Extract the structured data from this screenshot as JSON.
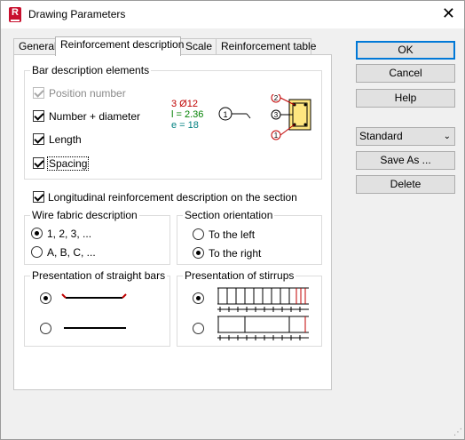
{
  "window": {
    "title": "Drawing Parameters",
    "app_icon_letter": "R"
  },
  "tabs": [
    "General",
    "Reinforcement description",
    "Scale",
    "Reinforcement table"
  ],
  "buttons": {
    "ok": "OK",
    "cancel": "Cancel",
    "help": "Help",
    "save_as": "Save As ...",
    "delete": "Delete"
  },
  "style_combo": {
    "value": "Standard"
  },
  "bar_description": {
    "title": "Bar description elements",
    "items": [
      {
        "label": "Position number",
        "checked": true,
        "disabled": true
      },
      {
        "label": "Number + diameter",
        "checked": true,
        "disabled": false
      },
      {
        "label": "Length",
        "checked": true,
        "disabled": false
      },
      {
        "label": "Spacing",
        "checked": true,
        "disabled": false
      }
    ],
    "preview": {
      "number_diameter": "3 Ø12",
      "length": "l = 2.36",
      "spacing": "e = 18",
      "position_marker": "1",
      "section_markers": [
        "2",
        "3",
        "1"
      ]
    },
    "colors": {
      "red": "#c00000",
      "green": "#008000",
      "teal": "#008080"
    }
  },
  "longitudinal": {
    "label": "Longitudinal reinforcement description on the section",
    "checked": true
  },
  "wire_fabric": {
    "title": "Wire fabric description",
    "options": [
      {
        "label": "1, 2, 3, ...",
        "checked": true
      },
      {
        "label": "A, B, C, ...",
        "checked": false
      }
    ]
  },
  "section_orientation": {
    "title": "Section orientation",
    "options": [
      {
        "label": "To the left",
        "checked": false
      },
      {
        "label": "To the right",
        "checked": true
      }
    ]
  },
  "straight_bars": {
    "title": "Presentation of straight bars",
    "selected": 0
  },
  "stirrups": {
    "title": "Presentation of stirrups",
    "selected": 0
  }
}
